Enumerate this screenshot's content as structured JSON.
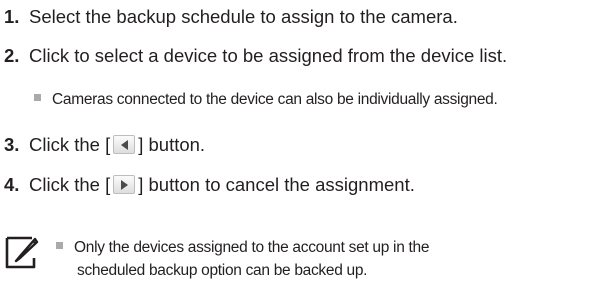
{
  "steps": [
    {
      "number": "1.",
      "text": "Select the backup schedule to assign to the camera."
    },
    {
      "number": "2.",
      "text": "Click to select a device to be assigned from the device list."
    },
    {
      "number": "3.",
      "text_before": "Click the [",
      "text_after": "] button.",
      "button_icon": "left-arrow-icon"
    },
    {
      "number": "4.",
      "text_before": "Click the [",
      "text_after": "] button to cancel the assignment.",
      "button_icon": "right-arrow-icon"
    }
  ],
  "sub_bullet": "Cameras connected to the device can also be individually assigned.",
  "note": {
    "icon": "note-pencil-icon",
    "line1": "Only the devices assigned to the account set up in the",
    "line2": "scheduled backup option can be backed up."
  }
}
